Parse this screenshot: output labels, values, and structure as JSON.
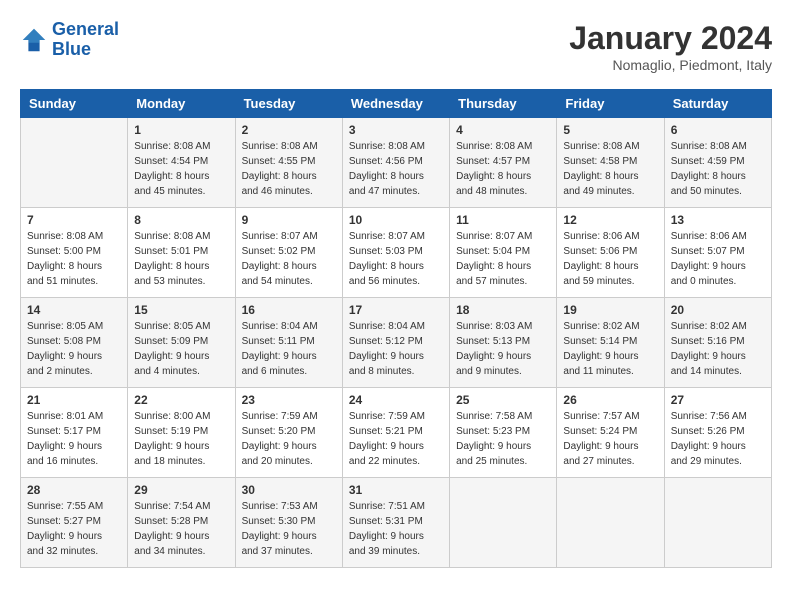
{
  "header": {
    "logo_line1": "General",
    "logo_line2": "Blue",
    "month": "January 2024",
    "location": "Nomaglio, Piedmont, Italy"
  },
  "weekdays": [
    "Sunday",
    "Monday",
    "Tuesday",
    "Wednesday",
    "Thursday",
    "Friday",
    "Saturday"
  ],
  "weeks": [
    [
      {
        "day": null
      },
      {
        "day": 1,
        "sunrise": "8:08 AM",
        "sunset": "4:54 PM",
        "daylight": "8 hours and 45 minutes."
      },
      {
        "day": 2,
        "sunrise": "8:08 AM",
        "sunset": "4:55 PM",
        "daylight": "8 hours and 46 minutes."
      },
      {
        "day": 3,
        "sunrise": "8:08 AM",
        "sunset": "4:56 PM",
        "daylight": "8 hours and 47 minutes."
      },
      {
        "day": 4,
        "sunrise": "8:08 AM",
        "sunset": "4:57 PM",
        "daylight": "8 hours and 48 minutes."
      },
      {
        "day": 5,
        "sunrise": "8:08 AM",
        "sunset": "4:58 PM",
        "daylight": "8 hours and 49 minutes."
      },
      {
        "day": 6,
        "sunrise": "8:08 AM",
        "sunset": "4:59 PM",
        "daylight": "8 hours and 50 minutes."
      }
    ],
    [
      {
        "day": 7,
        "sunrise": "8:08 AM",
        "sunset": "5:00 PM",
        "daylight": "8 hours and 51 minutes."
      },
      {
        "day": 8,
        "sunrise": "8:08 AM",
        "sunset": "5:01 PM",
        "daylight": "8 hours and 53 minutes."
      },
      {
        "day": 9,
        "sunrise": "8:07 AM",
        "sunset": "5:02 PM",
        "daylight": "8 hours and 54 minutes."
      },
      {
        "day": 10,
        "sunrise": "8:07 AM",
        "sunset": "5:03 PM",
        "daylight": "8 hours and 56 minutes."
      },
      {
        "day": 11,
        "sunrise": "8:07 AM",
        "sunset": "5:04 PM",
        "daylight": "8 hours and 57 minutes."
      },
      {
        "day": 12,
        "sunrise": "8:06 AM",
        "sunset": "5:06 PM",
        "daylight": "8 hours and 59 minutes."
      },
      {
        "day": 13,
        "sunrise": "8:06 AM",
        "sunset": "5:07 PM",
        "daylight": "9 hours and 0 minutes."
      }
    ],
    [
      {
        "day": 14,
        "sunrise": "8:05 AM",
        "sunset": "5:08 PM",
        "daylight": "9 hours and 2 minutes."
      },
      {
        "day": 15,
        "sunrise": "8:05 AM",
        "sunset": "5:09 PM",
        "daylight": "9 hours and 4 minutes."
      },
      {
        "day": 16,
        "sunrise": "8:04 AM",
        "sunset": "5:11 PM",
        "daylight": "9 hours and 6 minutes."
      },
      {
        "day": 17,
        "sunrise": "8:04 AM",
        "sunset": "5:12 PM",
        "daylight": "9 hours and 8 minutes."
      },
      {
        "day": 18,
        "sunrise": "8:03 AM",
        "sunset": "5:13 PM",
        "daylight": "9 hours and 9 minutes."
      },
      {
        "day": 19,
        "sunrise": "8:02 AM",
        "sunset": "5:14 PM",
        "daylight": "9 hours and 11 minutes."
      },
      {
        "day": 20,
        "sunrise": "8:02 AM",
        "sunset": "5:16 PM",
        "daylight": "9 hours and 14 minutes."
      }
    ],
    [
      {
        "day": 21,
        "sunrise": "8:01 AM",
        "sunset": "5:17 PM",
        "daylight": "9 hours and 16 minutes."
      },
      {
        "day": 22,
        "sunrise": "8:00 AM",
        "sunset": "5:19 PM",
        "daylight": "9 hours and 18 minutes."
      },
      {
        "day": 23,
        "sunrise": "7:59 AM",
        "sunset": "5:20 PM",
        "daylight": "9 hours and 20 minutes."
      },
      {
        "day": 24,
        "sunrise": "7:59 AM",
        "sunset": "5:21 PM",
        "daylight": "9 hours and 22 minutes."
      },
      {
        "day": 25,
        "sunrise": "7:58 AM",
        "sunset": "5:23 PM",
        "daylight": "9 hours and 25 minutes."
      },
      {
        "day": 26,
        "sunrise": "7:57 AM",
        "sunset": "5:24 PM",
        "daylight": "9 hours and 27 minutes."
      },
      {
        "day": 27,
        "sunrise": "7:56 AM",
        "sunset": "5:26 PM",
        "daylight": "9 hours and 29 minutes."
      }
    ],
    [
      {
        "day": 28,
        "sunrise": "7:55 AM",
        "sunset": "5:27 PM",
        "daylight": "9 hours and 32 minutes."
      },
      {
        "day": 29,
        "sunrise": "7:54 AM",
        "sunset": "5:28 PM",
        "daylight": "9 hours and 34 minutes."
      },
      {
        "day": 30,
        "sunrise": "7:53 AM",
        "sunset": "5:30 PM",
        "daylight": "9 hours and 37 minutes."
      },
      {
        "day": 31,
        "sunrise": "7:51 AM",
        "sunset": "5:31 PM",
        "daylight": "9 hours and 39 minutes."
      },
      {
        "day": null
      },
      {
        "day": null
      },
      {
        "day": null
      }
    ]
  ],
  "labels": {
    "sunrise": "Sunrise:",
    "sunset": "Sunset:",
    "daylight": "Daylight:"
  }
}
